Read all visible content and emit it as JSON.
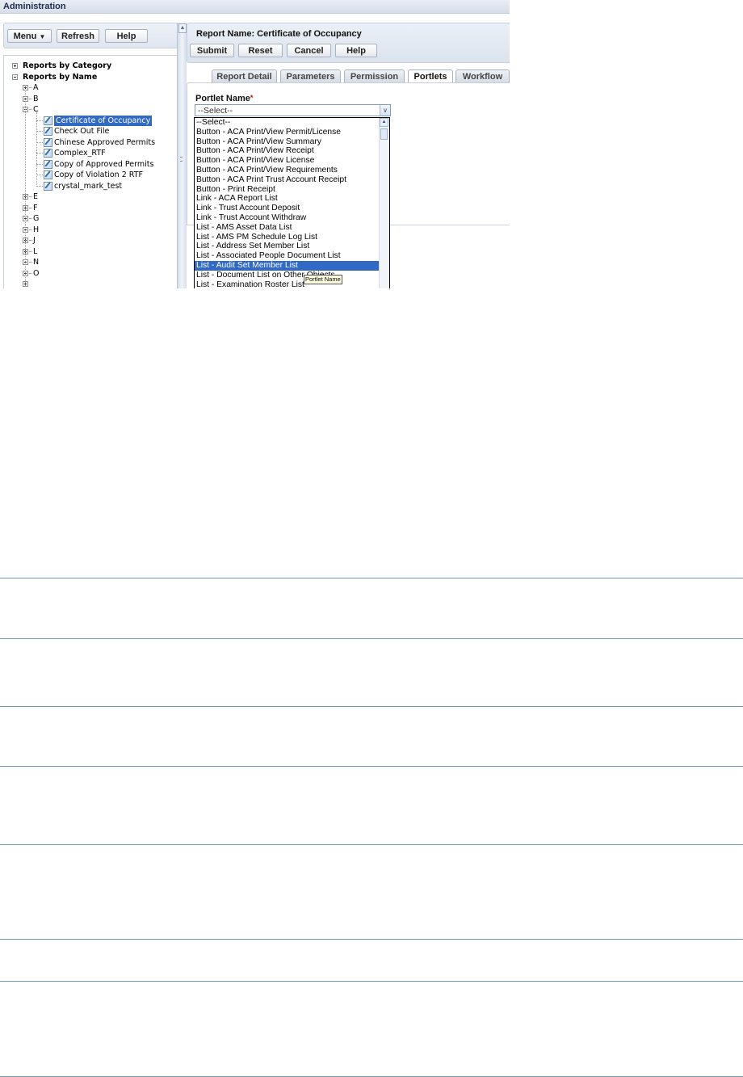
{
  "window": {
    "title": "Administration"
  },
  "left_toolbar": {
    "menu_label": "Menu",
    "refresh_label": "Refresh",
    "help_label": "Help"
  },
  "tree": {
    "root_items": [
      "Reports by Category",
      "Reports by Name"
    ],
    "letters_top": [
      "A",
      "B",
      "C"
    ],
    "c_children": [
      "Certificate of Occupancy",
      "Check Out File",
      "Chinese Approved Permits",
      "Complex_RTF",
      "Copy of Approved Permits",
      "Copy of Violation 2 RTF",
      "crystal_mark_test"
    ],
    "selected": "Certificate of Occupancy",
    "letters_bottom": [
      "E",
      "F",
      "G",
      "H",
      "J",
      "L",
      "N",
      "O"
    ]
  },
  "report": {
    "title": "Report Name: Certificate of Occupancy",
    "buttons": {
      "submit": "Submit",
      "reset": "Reset",
      "cancel": "Cancel",
      "help": "Help"
    }
  },
  "tabs": [
    {
      "label": "Report Detail",
      "active": false
    },
    {
      "label": "Parameters",
      "active": false
    },
    {
      "label": "Permission",
      "active": false
    },
    {
      "label": "Portlets",
      "active": true
    },
    {
      "label": "Workflow",
      "active": false
    }
  ],
  "portlet": {
    "label": "Portlet Name",
    "required_mark": "*",
    "selected_value": "--Select--",
    "options": [
      "--Select--",
      "Button - ACA Print/View Permit/License",
      "Button - ACA Print/View Summary",
      "Button - ACA Print/View Receipt",
      "Button - ACA Print/View License",
      "Button - ACA Print/View Requirements",
      "Button - ACA Print Trust Account Receipt",
      "Button - Print Receipt",
      "Link - ACA Report List",
      "Link - Trust Account Deposit",
      "Link - Trust Account Withdraw",
      "List - AMS Asset Data List",
      "List - AMS PM Schedule Log List",
      "List - Address Set Member List",
      "List - Associated People Document List",
      "List - Audit Set Member List",
      "List - Document List on Other Objects",
      "List - Examination Roster List"
    ],
    "highlighted_option": "List - Audit Set Member List",
    "tooltip": "Portlet Name"
  },
  "colors": {
    "selection": "#316ac5",
    "rule_line": "#6f9aaf",
    "header_bg": "#dbe3ee"
  }
}
